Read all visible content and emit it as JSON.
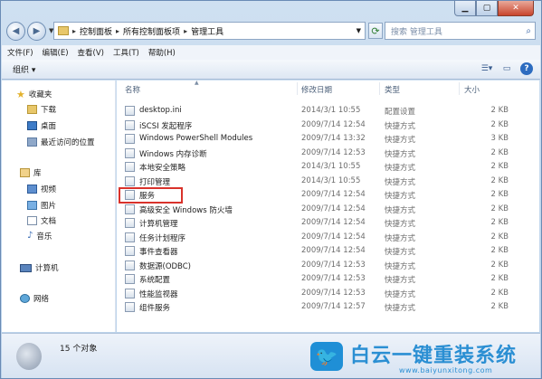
{
  "window": {
    "caption": {
      "minimize": "▁",
      "maximize": "▢",
      "close": "✕"
    }
  },
  "address_bar": {
    "crumbs": [
      "控制面板",
      "所有控制面板项",
      "管理工具"
    ],
    "search_placeholder": "搜索 管理工具"
  },
  "menubar": {
    "items": [
      "文件(F)",
      "编辑(E)",
      "查看(V)",
      "工具(T)",
      "帮助(H)"
    ]
  },
  "toolbar": {
    "organize_label": "组织 ▾"
  },
  "nav_pane": {
    "favorites_header": "收藏夹",
    "favorites": [
      "下载",
      "桌面",
      "最近访问的位置"
    ],
    "libraries_header": "库",
    "libraries": [
      "视频",
      "图片",
      "文档",
      "音乐"
    ],
    "computer": "计算机",
    "network": "网络"
  },
  "file_list": {
    "columns": {
      "name": "名称",
      "modified": "修改日期",
      "type": "类型",
      "size": "大小"
    },
    "rows": [
      {
        "name": "desktop.ini",
        "modified": "2014/3/1 10:55",
        "type": "配置设置",
        "size": "2 KB"
      },
      {
        "name": "iSCSI 发起程序",
        "modified": "2009/7/14 12:54",
        "type": "快捷方式",
        "size": "2 KB"
      },
      {
        "name": "Windows PowerShell Modules",
        "modified": "2009/7/14 13:32",
        "type": "快捷方式",
        "size": "3 KB"
      },
      {
        "name": "Windows 内存诊断",
        "modified": "2009/7/14 12:53",
        "type": "快捷方式",
        "size": "2 KB"
      },
      {
        "name": "本地安全策略",
        "modified": "2014/3/1 10:55",
        "type": "快捷方式",
        "size": "2 KB"
      },
      {
        "name": "打印管理",
        "modified": "2014/3/1 10:55",
        "type": "快捷方式",
        "size": "2 KB"
      },
      {
        "name": "服务",
        "modified": "2009/7/14 12:54",
        "type": "快捷方式",
        "size": "2 KB"
      },
      {
        "name": "高级安全 Windows 防火墙",
        "modified": "2009/7/14 12:54",
        "type": "快捷方式",
        "size": "2 KB"
      },
      {
        "name": "计算机管理",
        "modified": "2009/7/14 12:54",
        "type": "快捷方式",
        "size": "2 KB"
      },
      {
        "name": "任务计划程序",
        "modified": "2009/7/14 12:54",
        "type": "快捷方式",
        "size": "2 KB"
      },
      {
        "name": "事件查看器",
        "modified": "2009/7/14 12:54",
        "type": "快捷方式",
        "size": "2 KB"
      },
      {
        "name": "数据源(ODBC)",
        "modified": "2009/7/14 12:53",
        "type": "快捷方式",
        "size": "2 KB"
      },
      {
        "name": "系统配置",
        "modified": "2009/7/14 12:53",
        "type": "快捷方式",
        "size": "2 KB"
      },
      {
        "name": "性能监视器",
        "modified": "2009/7/14 12:53",
        "type": "快捷方式",
        "size": "2 KB"
      },
      {
        "name": "组件服务",
        "modified": "2009/7/14 12:57",
        "type": "快捷方式",
        "size": "2 KB"
      }
    ]
  },
  "status_bar": {
    "item_count": "15 个对象"
  },
  "watermark": {
    "title": "白云一键重装系统",
    "url": "www.baiyunxitong.com"
  },
  "colors": {
    "highlight_border": "#d9322b",
    "window_frame": "#b9d1ea",
    "watermark_blue": "#2b8fd3"
  }
}
